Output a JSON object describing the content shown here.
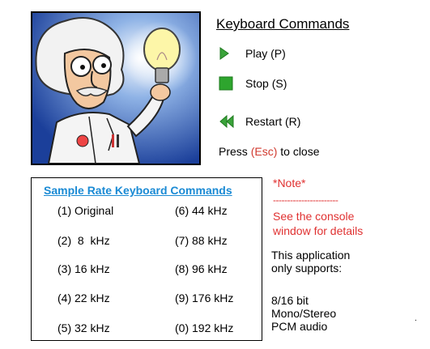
{
  "keyboard": {
    "title": "Keyboard Commands",
    "commands": [
      {
        "label": "Play (P)",
        "icon": "play-icon",
        "color": "#3aa33a"
      },
      {
        "label": "Stop (S)",
        "icon": "stop-icon",
        "color": "#2ea52e"
      },
      {
        "label": "Restart (R)",
        "icon": "rewind-icon",
        "color": "#3aa33a"
      }
    ],
    "close_prefix": "Press ",
    "close_key": "(Esc)",
    "close_suffix": " to close"
  },
  "sample_rate": {
    "title": "Sample Rate Keyboard Commands",
    "left": [
      "(1) Original",
      "(2)  8  kHz",
      "(3) 16 kHz",
      "(4) 22 kHz",
      "(5) 32 kHz"
    ],
    "right": [
      "(6) 44 kHz",
      "(7) 88 kHz",
      "(8) 96 kHz",
      "(9) 176 kHz",
      "(0) 192 kHz"
    ]
  },
  "note": {
    "title": "*Note*",
    "divider": "-----------------------",
    "line1": "See the console",
    "line2": "window for details"
  },
  "support": {
    "line1": "This application",
    "line2": "only supports:",
    "format1": "8/16 bit",
    "format2": "Mono/Stereo",
    "format3": "PCM audio",
    "dot": "."
  },
  "colors": {
    "accent_blue": "#1a8ad4",
    "note_red": "#e03131",
    "icon_green": "#3aa33a"
  },
  "illustration": {
    "icon": "scientist-lightbulb-illustration"
  }
}
